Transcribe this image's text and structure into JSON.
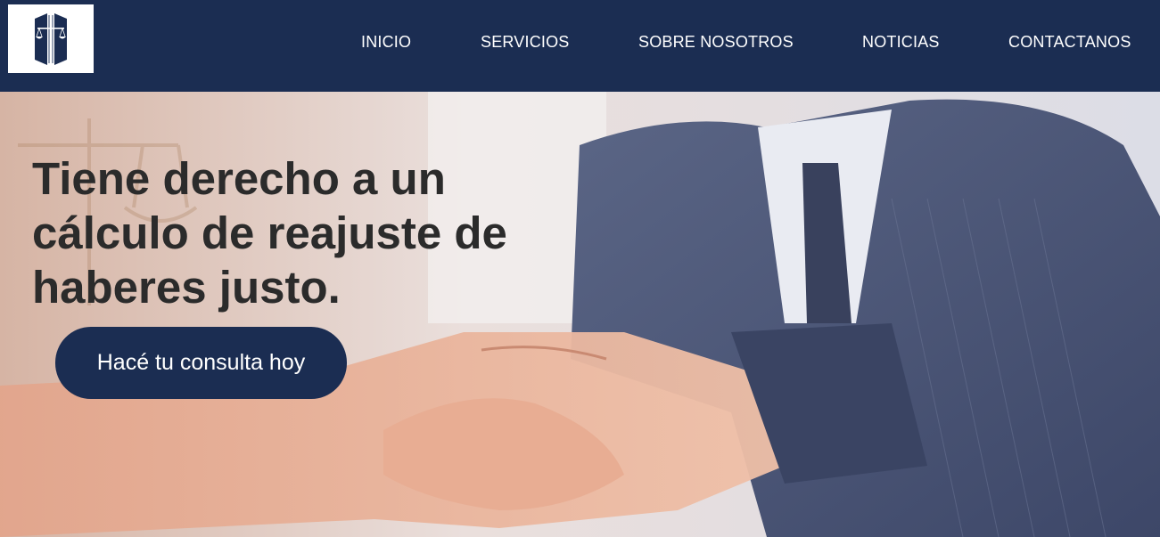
{
  "header": {
    "logo_icon": "law-firm-scales-logo",
    "nav": [
      {
        "label": "INICIO"
      },
      {
        "label": "SERVICIOS"
      },
      {
        "label": "SOBRE NOSOTROS"
      },
      {
        "label": "NOTICIAS"
      },
      {
        "label": "CONTACTANOS"
      }
    ]
  },
  "hero": {
    "headline": "Tiene derecho a un cálculo de reajuste de haberes justo.",
    "cta_label": "Hacé tu consulta hoy",
    "background_image": "handshake-photo"
  },
  "colors": {
    "brand_navy": "#1b2d52",
    "headline_text": "#2b2b2b",
    "nav_text": "#ffffff"
  }
}
